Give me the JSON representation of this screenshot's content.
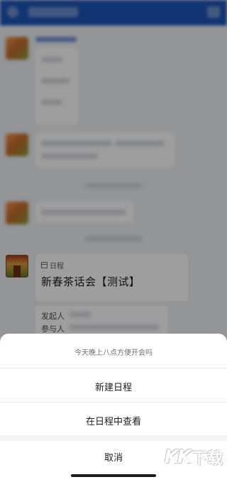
{
  "chat": {
    "schedule_card": {
      "tag": "日程",
      "title": "新春茶话会【测试】",
      "organizer_label": "发起人",
      "participants_label": "参与人"
    }
  },
  "action_sheet": {
    "title": "今天晚上八点方便开会吗",
    "items": [
      {
        "label": "新建日程"
      },
      {
        "label": "在日程中查看"
      }
    ],
    "cancel_label": "取消"
  },
  "watermark": {
    "text_kk": "KK",
    "text_dl": "下载"
  },
  "colors": {
    "header_blue": "#1f55b8",
    "overlay": "rgba(0,0,0,0.38)"
  }
}
